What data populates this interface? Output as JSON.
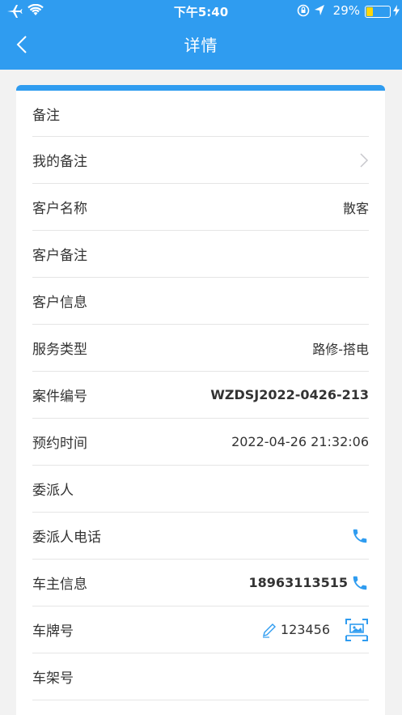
{
  "status_bar": {
    "time": "下午5:40",
    "battery_pct": "29%"
  },
  "nav": {
    "title": "详情"
  },
  "colors": {
    "primary": "#2f9cf0",
    "battery": "#ffd60a"
  },
  "rows": {
    "remark": {
      "label": "备注"
    },
    "my_remark": {
      "label": "我的备注"
    },
    "customer_name": {
      "label": "客户名称",
      "value": "散客"
    },
    "customer_remark": {
      "label": "客户备注"
    },
    "customer_info": {
      "label": "客户信息"
    },
    "service_type": {
      "label": "服务类型",
      "value": "路修-搭电"
    },
    "case_no": {
      "label": "案件编号",
      "value": "WZDSJ2022-0426-213"
    },
    "appointment_time": {
      "label": "预约时间",
      "value": "2022-04-26 21:32:06"
    },
    "assigner": {
      "label": "委派人"
    },
    "assigner_phone": {
      "label": "委派人电话"
    },
    "owner_info": {
      "label": "车主信息",
      "value": "18963113515"
    },
    "plate_no": {
      "label": "车牌号",
      "value": "123456"
    },
    "frame_no": {
      "label": "车架号"
    }
  }
}
